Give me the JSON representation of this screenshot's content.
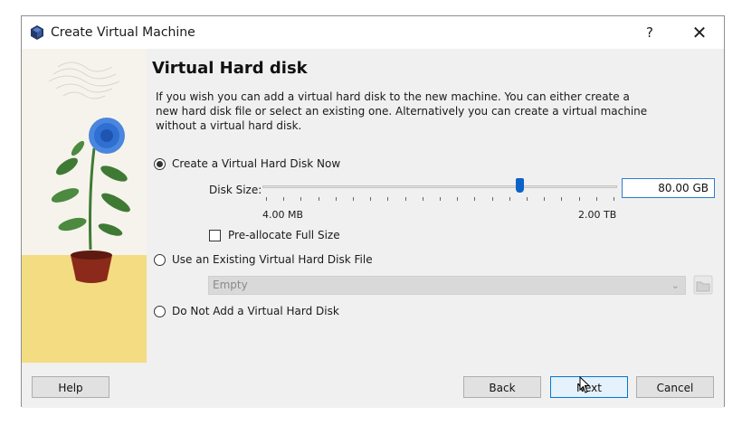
{
  "window": {
    "title": "Create Virtual Machine",
    "help_glyph": "?",
    "close_glyph": "✕"
  },
  "page": {
    "heading": "Virtual Hard disk",
    "description": "If you wish you can add a virtual hard disk to the new machine. You can either create a new hard disk file or select an existing one. Alternatively you can create a virtual machine without a virtual hard disk."
  },
  "options": {
    "create_now": {
      "label": "Create a Virtual Hard Disk Now",
      "checked": true
    },
    "use_existing": {
      "label": "Use an Existing Virtual Hard Disk File",
      "checked": false
    },
    "no_disk": {
      "label": "Do Not Add a Virtual Hard Disk",
      "checked": false
    }
  },
  "disk_size": {
    "label": "Disk Size:",
    "value": "80.00 GB",
    "range_min": "4.00 MB",
    "range_max": "2.00 TB",
    "slider_fraction": 0.73
  },
  "preallocate": {
    "label": "Pre-allocate Full Size",
    "checked": false
  },
  "existing_file": {
    "value": "Empty",
    "enabled": false
  },
  "buttons": {
    "help": "Help",
    "back": "Back",
    "next": "Next",
    "cancel": "Cancel"
  },
  "colors": {
    "accent": "#0b63c9",
    "focus_border": "#0078d7",
    "art_sand": "#f4dc83",
    "art_pot": "#8b2a1a",
    "art_flower": "#2f6fd1",
    "art_leaf": "#3f7a35"
  },
  "icons": {
    "app": "virtualbox-cube-icon",
    "folder": "folder-open-icon",
    "cursor": "mouse-pointer-icon"
  }
}
